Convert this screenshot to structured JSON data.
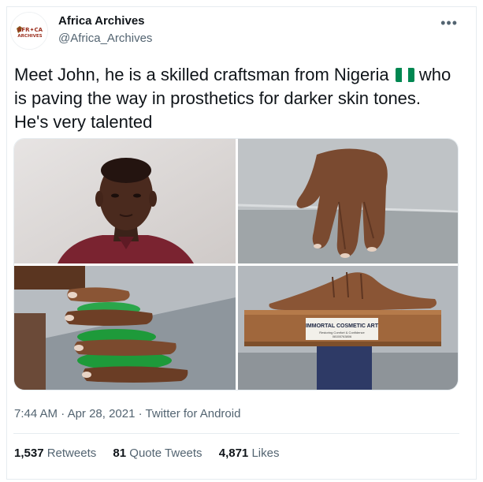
{
  "author": {
    "name": "Africa Archives",
    "handle": "@Africa_Archives",
    "avatar_logo_text": "AFRICA ARCHIVES"
  },
  "tweet": {
    "text": "Meet John, he is a skilled craftsman from Nigeria",
    "text_after_flag": "who is paving the way in prosthetics for darker skin tones. He's very talented",
    "flag_emoji": "nigeria-flag",
    "images": [
      {
        "name": "portrait-photo"
      },
      {
        "name": "prosthetic-hand-photo"
      },
      {
        "name": "prosthetic-fingers-photo"
      },
      {
        "name": "prosthetic-hand-box-photo",
        "box_label": "IMMORTAL COSMETIC ART"
      }
    ]
  },
  "meta": {
    "time": "7:44 AM",
    "date": "Apr 28, 2021",
    "separator": "·",
    "source": "Twitter for Android"
  },
  "stats": {
    "retweets_count": "1,537",
    "retweets_label": "Retweets",
    "quotes_count": "81",
    "quotes_label": "Quote Tweets",
    "likes_count": "4,871",
    "likes_label": "Likes"
  },
  "menu_icon": "more-options-icon",
  "colors": {
    "text": "#0f1419",
    "secondary": "#536471",
    "border": "#e6ecf0",
    "flag_green": "#008751"
  }
}
